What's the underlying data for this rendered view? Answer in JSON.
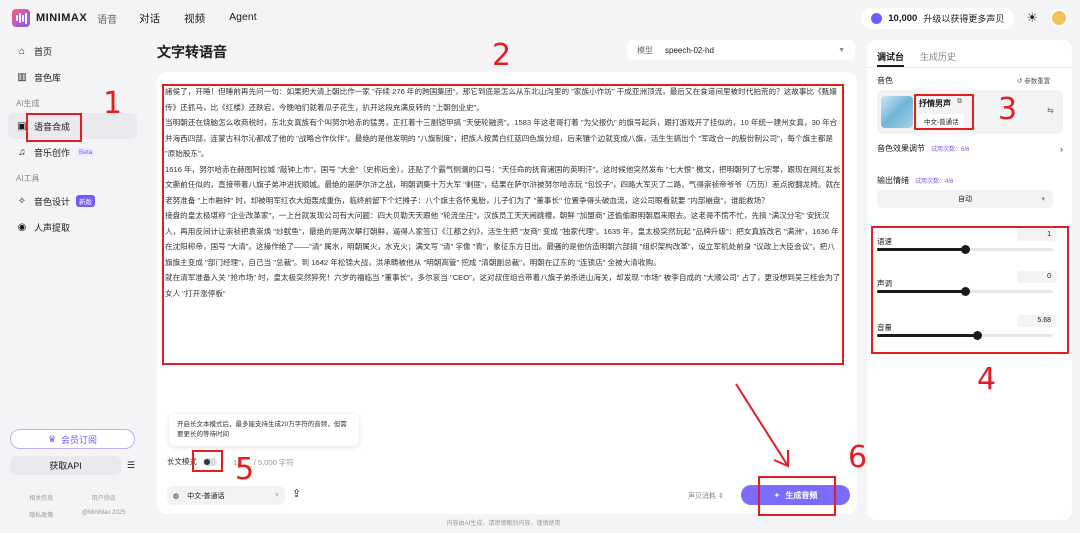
{
  "topbar": {
    "brand": "MINIMAX",
    "brand_sub": "语音",
    "nav": [
      "对话",
      "视频",
      "Agent"
    ],
    "credits": "10,000",
    "upgrade": "升级以获得更多声贝"
  },
  "sidebar": {
    "items": [
      {
        "label": "首页",
        "icon": "home-icon"
      },
      {
        "label": "音色库",
        "icon": "library-icon"
      }
    ],
    "section_gen": "AI生成",
    "gen_items": [
      {
        "label": "语音合成",
        "icon": "tts-icon",
        "active": true
      },
      {
        "label": "音乐创作",
        "icon": "music-icon",
        "badge": "Beta"
      }
    ],
    "section_tools": "AI工具",
    "tool_items": [
      {
        "label": "音色设计",
        "icon": "design-icon",
        "badge": "新版"
      },
      {
        "label": "人声提取",
        "icon": "extract-icon"
      }
    ],
    "subscribe": "会员订阅",
    "get_api": "获取API",
    "footer": [
      "相关信息",
      "用户协议",
      "隐私政策",
      "@MiniMax 2025"
    ]
  },
  "main": {
    "title": "文字转语音",
    "model_label": "模型",
    "model_value": "speech-02-hd",
    "text_paragraphs": [
      "諸侯了，开睡！但睡前再先问一句：如果把大清上朝比作一家 \"存续 276 年的跨国集团\"，那它到底是怎么从东北山沟里的 \"家族小作坊\" 干成亚洲顶流，最后又在食道间里被时代拍荒的？这故事比《甄嬛传》还抓马，比《红楼》还跌宕，今晚咱们就着瓜子花生，扒开这段充满反转的 \"上朝创业史\"。",
      "当明朝还在烧脑怎么收商税时，东北女真族有个叫努尔哈赤的猛男，正扛着十三副铠甲搞 \"天使轮融资\"。1583 年这老哥打着 \"为父报仇\" 的旗号起兵，跟打游戏开了挂似的，10 年统一建州女真，30 年合并海西四部，连蒙古科尔沁都成了他的 \"战略合作伙伴\"。最绝的是他发明的 \"八旗制度\"，把族人按黄白红蓝四色旗分组，后来镶个边就变成八旗，活生生搞出个 \"军政合一的股份制公司\"，每个旗主都是 \"原始股东\"。",
      "1616 年，努尔哈赤在赫图阿拉城 \"敲钟上市\"，国号 \"大金\"（史称后金），还贴了个霸气侧漏的口号：\"天任命的抚育诸国的英明汗\"。这时候他突然发布 \"七大恨\" 檄文，把明朝列了七宗罪，跟现在网红发长文撕前任似的，直接带着八旗子弟冲进抚顺城。最绝的是萨尔浒之战，明朝调集十万大军 \"剿匪\"，结果在萨尔浒被努尔哈赤玩 \"包饺子\"，四路大军灭了二路，气得崇祯帝爷爷（万历）差点掀翻龙椅。就在老努准备 \"上市融钟\" 时，却被明军红衣大炮轰成重伤，临终前留下个烂摊子：八个旗主各怀鬼胎，儿子们为了 \"董事长\" 位置争得头破血流，这公司眼看就要 \"内部崩盘\"，谁能救场？",
      "接盘的皇太极堪称 \"企业改革家\"，一上台就发现公司有大问题：四大贝勒天天跟他 \"轮流坐庄\"，汉族员工天天闹跳槽，朝鲜 \"加盟商\" 还偷偷跟明朝眉来眼去。这老哥不慌不忙，先搞 \"满汉分宅\" 安抚汉人，再用反间计让崇祯把袁崇焕 \"炒鱿鱼\"，最绝的是两次攀打朝鲜，逼得人家签订《江都之约》，活生生把 \"友商\" 变成 \"独家代理\"。1635 年，皇太极突然玩起 \"品牌升级\"：把女真族改名 \"满洲\"，1636 年在沈阳称帝，国号 \"大清\"。这操作绝了——\"清\" 属水，明朝属火，水克火；满文写 \"清\" 字像 \"青\"，象征东方日出。最骚的是他仿造明朝六部搞 \"组织架构改革\"，设立军机处前身 \"议政上大臣会议\"，把八旗旗主变成 \"部门经理\"，自己当 \"总裁\"。到 1642 年松锦大战，洪承畴被他从 \"明朝高管\" 挖成 \"清朝副总裁\"，明朝在辽东的 \"连锁店\" 全被大清收购。",
      "就在清军准备入关 \"抢市场\" 时，皇太极突然猝死！六岁的福临当 \"董事长\"，多尔衮当 \"CEO\"，这对叔侄组合带着八旗子弟杀进山海关，却发现 \"市场\" 被李自成的 \"大顺公司\" 占了，更没想到吴三桂会为了女人 \"打开涨停板\""
    ],
    "tooltip": "开启长文本模式后，最多能支持生成20万字符的音频，但需要更长的等待时间",
    "long_mode_label": "长文模式",
    "char_count": "1,1__ / 5,000 字符",
    "language_tag": "中文-普通话",
    "voice_credit": "声贝消耗",
    "generate_label": "生成音频",
    "disclaimer": "内容由AI生成，请审慎甄别内容，谨慎使用"
  },
  "right_panel": {
    "tab_debug": "调试台",
    "tab_history": "生成历史",
    "voice_section": "音色",
    "reset": "参数重置",
    "voice_name": "抒情男声",
    "voice_lang": "中文-普通话",
    "effect_label": "音色效果调节",
    "effect_trial": "试用次数：6/6",
    "emotion_label": "输出情绪",
    "emotion_trial": "试用次数：4/6",
    "emotion_value": "自动",
    "sliders": [
      {
        "label": "语速",
        "value": "1",
        "fraction": 0.5
      },
      {
        "label": "声调",
        "value": "0",
        "fraction": 0.5
      },
      {
        "label": "音量",
        "value": "5.68",
        "fraction": 0.57
      }
    ]
  },
  "annotations": {
    "n1": "1",
    "n2": "2",
    "n3": "3",
    "n4": "4",
    "n5": "5",
    "n6": "6",
    "color": "#e41e1e"
  }
}
